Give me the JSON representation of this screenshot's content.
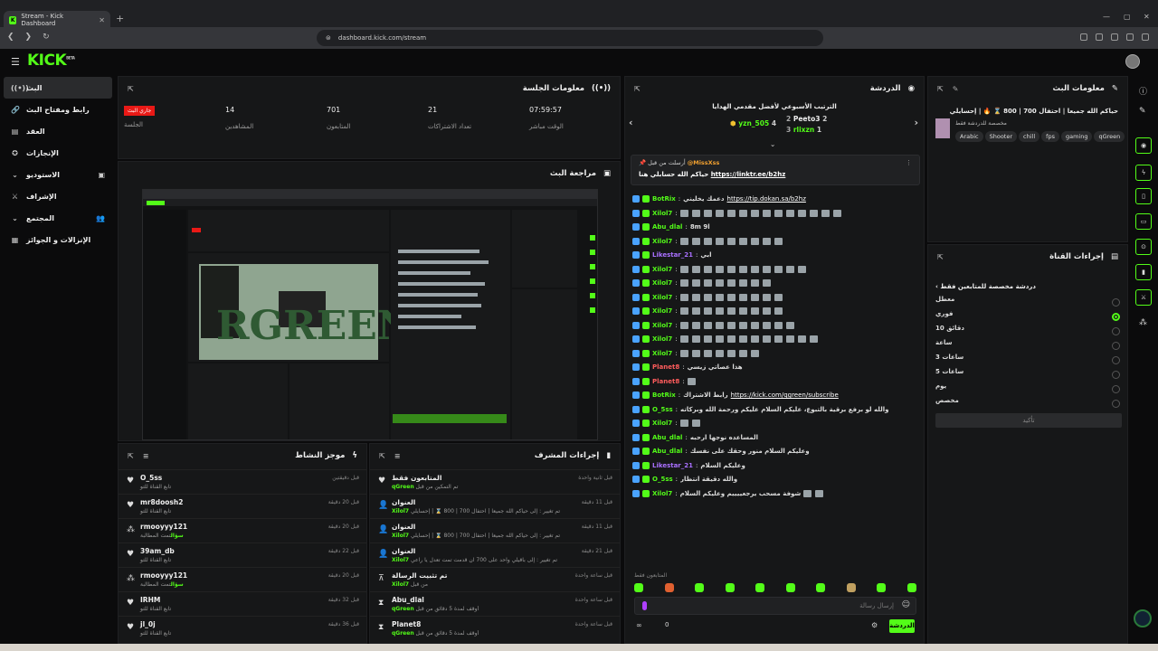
{
  "browser": {
    "tab_title": "Stream - Kick Dashboard",
    "url": "dashboard.kick.com/stream"
  },
  "brand": {
    "logo": "KICK",
    "logo_sup": "BETA",
    "accent": "#53fc18",
    "live_red": "#e91916"
  },
  "sidebar": {
    "items": [
      {
        "label": "البث",
        "icon": "broadcast-icon"
      },
      {
        "label": "رابط ومفتاح البث",
        "icon": "link-icon"
      },
      {
        "label": "العقد",
        "icon": "contract-icon"
      },
      {
        "label": "الإنجازات",
        "icon": "trophy-icon"
      },
      {
        "label": "الاستوديو",
        "icon": "studio-icon"
      },
      {
        "label": "الإشراف",
        "icon": "sword-icon"
      },
      {
        "label": "المجتمع",
        "icon": "community-icon"
      },
      {
        "label": "الإنزالات و الجوائز",
        "icon": "gift-icon"
      }
    ]
  },
  "session": {
    "title": "معلومات الجلسة",
    "live_badge": "جاري البث",
    "session_label": "الجلسة",
    "stats": [
      {
        "value": "14",
        "label": "المشاهدين"
      },
      {
        "value": "701",
        "label": "المتابعون"
      },
      {
        "value": "21",
        "label": "تعداد الاشتراكات"
      },
      {
        "value": "07:59:57",
        "label": "الوقت مباشر"
      }
    ]
  },
  "preview": {
    "title": "مراجعة البث"
  },
  "activity": {
    "title": "موجز النشاط",
    "items": [
      {
        "name": "O_5ss",
        "desc": "تابع القناة للتو",
        "time": "قبل دقيقتين",
        "icon": "heart-icon"
      },
      {
        "name": "mr8doosh2",
        "desc": "تابع القناة للتو",
        "time": "قبل 20 دقيقة",
        "icon": "heart-icon"
      },
      {
        "name": "rmooyyy121",
        "desc": "تمت المطالبة",
        "desc_green": "سؤال",
        "time": "قبل 20 دقيقة",
        "icon": "points-icon"
      },
      {
        "name": "39am_db",
        "desc": "تابع القناة للتو",
        "time": "قبل 22 دقيقة",
        "icon": "heart-icon"
      },
      {
        "name": "rmooyyy121",
        "desc": "تمت المطالبة",
        "desc_green": "سؤال",
        "time": "قبل 20 دقيقة",
        "icon": "points-icon"
      },
      {
        "name": "IRHM",
        "desc": "تابع القناة للتو",
        "time": "قبل 32 دقيقة",
        "icon": "heart-icon"
      },
      {
        "name": "jl_0j",
        "desc": "تابع القناة للتو",
        "time": "قبل 36 دقيقة",
        "icon": "heart-icon"
      }
    ]
  },
  "modactions": {
    "title": "إجراءات المشرف",
    "items": [
      {
        "name": "المتابعون فقط",
        "desc": "تم التمكين من قبل",
        "desc_green": "qGreen",
        "time": "قبل ثانية واحدة",
        "icon": "heart-icon"
      },
      {
        "name": "العنوان",
        "desc": "تم تغيير : إلى حياكم الله جميعا | احتفال 700 | 800 ⌛ | إحسايلي",
        "desc_green": "Xilol7",
        "time": "قبل 11 دقيقة",
        "icon": "user-edit-icon"
      },
      {
        "name": "العنوان",
        "desc": "تم تغيير : إلى حياكم الله جميعا | احتفال 700 | 800 ⌛ | إحسايلي",
        "desc_green": "Xilol7",
        "time": "قبل 11 دقيقة",
        "icon": "user-edit-icon"
      },
      {
        "name": "العنوان",
        "desc": "تم تغيير : إلى باقيلي واحد على 700 ان قدمت تمت تعدل يا راعي",
        "desc_green": "Xilol7",
        "time": "قبل 21 دقيقة",
        "icon": "user-edit-icon"
      },
      {
        "name": "تم تثبيت الرسالة",
        "desc": "من قبل",
        "desc_green": "Xilol7",
        "time": "قبل ساعة واحدة",
        "icon": "pin-icon"
      },
      {
        "name": "Abu_dlal",
        "desc": "أوقف لمدة 5 دقائق من قبل",
        "desc_green": "qGreen",
        "time": "قبل ساعة واحدة",
        "icon": "hourglass-icon"
      },
      {
        "name": "Planet8",
        "desc": "أوقف لمدة 5 دقائق من قبل",
        "desc_green": "qGreen",
        "time": "قبل ساعة واحدة",
        "icon": "hourglass-icon"
      }
    ]
  },
  "chat": {
    "title": "الدردشة",
    "goal_title": "الترتيب الأسبوعي لأفضل مقدمي الهدايا",
    "goal": [
      {
        "rank": "1",
        "name": "yzn_505",
        "count": "4"
      },
      {
        "rank": "2",
        "name": "Peeto3",
        "count": "2"
      },
      {
        "rank": "3",
        "name": "rlixzn",
        "count": "1"
      }
    ],
    "pinned_by_label": "أرسلت من قبل",
    "pinned_user": "@MissXss",
    "pinned_text": "حياكم الله حسابلي هنا",
    "pinned_link": "https://linktr.ee/b2hz",
    "messages": [
      {
        "user": "BotRix",
        "color": "#53fc18",
        "text": "دعمك يخليني",
        "link": "https://tip.dokan.sa/b2hz",
        "emotes": 0
      },
      {
        "user": "Xilol7",
        "color": "#53fc18",
        "text": "",
        "link": "",
        "emotes": 14
      },
      {
        "user": "Abu_dlal",
        "color": "#53fc18",
        "text": "8m 9l",
        "link": "",
        "emotes": 0
      },
      {
        "user": "Xilol7",
        "color": "#53fc18",
        "text": "",
        "link": "",
        "emotes": 9
      },
      {
        "user": "Likestar_21",
        "color": "#a970ff",
        "text": "ابي",
        "link": "",
        "emotes": 0
      },
      {
        "user": "Xilol7",
        "color": "#53fc18",
        "text": "",
        "link": "",
        "emotes": 11
      },
      {
        "user": "Xilol7",
        "color": "#53fc18",
        "text": "",
        "link": "",
        "emotes": 8
      },
      {
        "user": "Xilol7",
        "color": "#53fc18",
        "text": "",
        "link": "",
        "emotes": 9
      },
      {
        "user": "Xilol7",
        "color": "#53fc18",
        "text": "",
        "link": "",
        "emotes": 9
      },
      {
        "user": "Xilol7",
        "color": "#53fc18",
        "text": "",
        "link": "",
        "emotes": 10
      },
      {
        "user": "Xilol7",
        "color": "#53fc18",
        "text": "",
        "link": "",
        "emotes": 12
      },
      {
        "user": "Xilol7",
        "color": "#53fc18",
        "text": "",
        "link": "",
        "emotes": 7
      },
      {
        "user": "Planet8",
        "color": "#ff5c5c",
        "text": "هذا عصاتي زيسي",
        "link": "",
        "emotes": 0
      },
      {
        "user": "Planet8",
        "color": "#ff5c5c",
        "text": "",
        "link": "",
        "emotes": 1
      },
      {
        "user": "BotRix",
        "color": "#53fc18",
        "text": "رابط الاشتراك",
        "link": "https://kick.com/qgreen/subscribe",
        "emotes": 0
      },
      {
        "user": "O_5ss",
        "color": "#53fc18",
        "text": "سامحت دقيقة كاملة انتظار عشان ارسل، والله لو برفع برقية بالتبوع، عليكم السلام عليكم ورحمة الله وبركاته",
        "link": "",
        "emotes": 0
      },
      {
        "user": "Xilol7",
        "color": "#53fc18",
        "text": "",
        "link": "",
        "emotes": 2
      },
      {
        "user": "Abu_dlal",
        "color": "#53fc18",
        "text": "المساعده نوجها ارحبه",
        "link": "",
        "emotes": 0
      },
      {
        "user": "Abu_dlal",
        "color": "#53fc18",
        "text": "وعليكم السلام منور وحقك على نفسك",
        "link": "",
        "emotes": 0
      },
      {
        "user": "Likestar_21",
        "color": "#a970ff",
        "text": "وعليكم السلام",
        "link": "",
        "emotes": 0
      },
      {
        "user": "O_5ss",
        "color": "#53fc18",
        "text": "والله دقيقة انتظار",
        "link": "",
        "emotes": 0
      },
      {
        "user": "Xilol7",
        "color": "#53fc18",
        "text": "شوفة مسحب يرجعييييم وعليكم السلام",
        "link": "",
        "emotes": 2
      }
    ],
    "followers_only": "المتابعون فقط",
    "input_placeholder": "إرسال رسالة",
    "send_label": "الدردشة",
    "footer_count": "0"
  },
  "stream_info": {
    "title": "معلومات البث",
    "stream_title": "حياكم الله جميعا | احتفال 700 | 800 ⌛ 🔥 | إحسايلي",
    "category": "مخصصة للدردشة فقط",
    "tags": [
      "Arabic",
      "Shooter",
      "chill",
      "fps",
      "gaming",
      "qGreen"
    ]
  },
  "channel_actions": {
    "title": "إجراءات القناة",
    "sub_title": "دردشة مخصصة للمتابعين فقط",
    "options": [
      "معطل",
      "فوري",
      "10 دقائق",
      "ساعة",
      "3 ساعات",
      "5 ساعات",
      "يوم",
      "مخصص"
    ],
    "selected_index": 1,
    "apply_label": "تأكيد"
  }
}
